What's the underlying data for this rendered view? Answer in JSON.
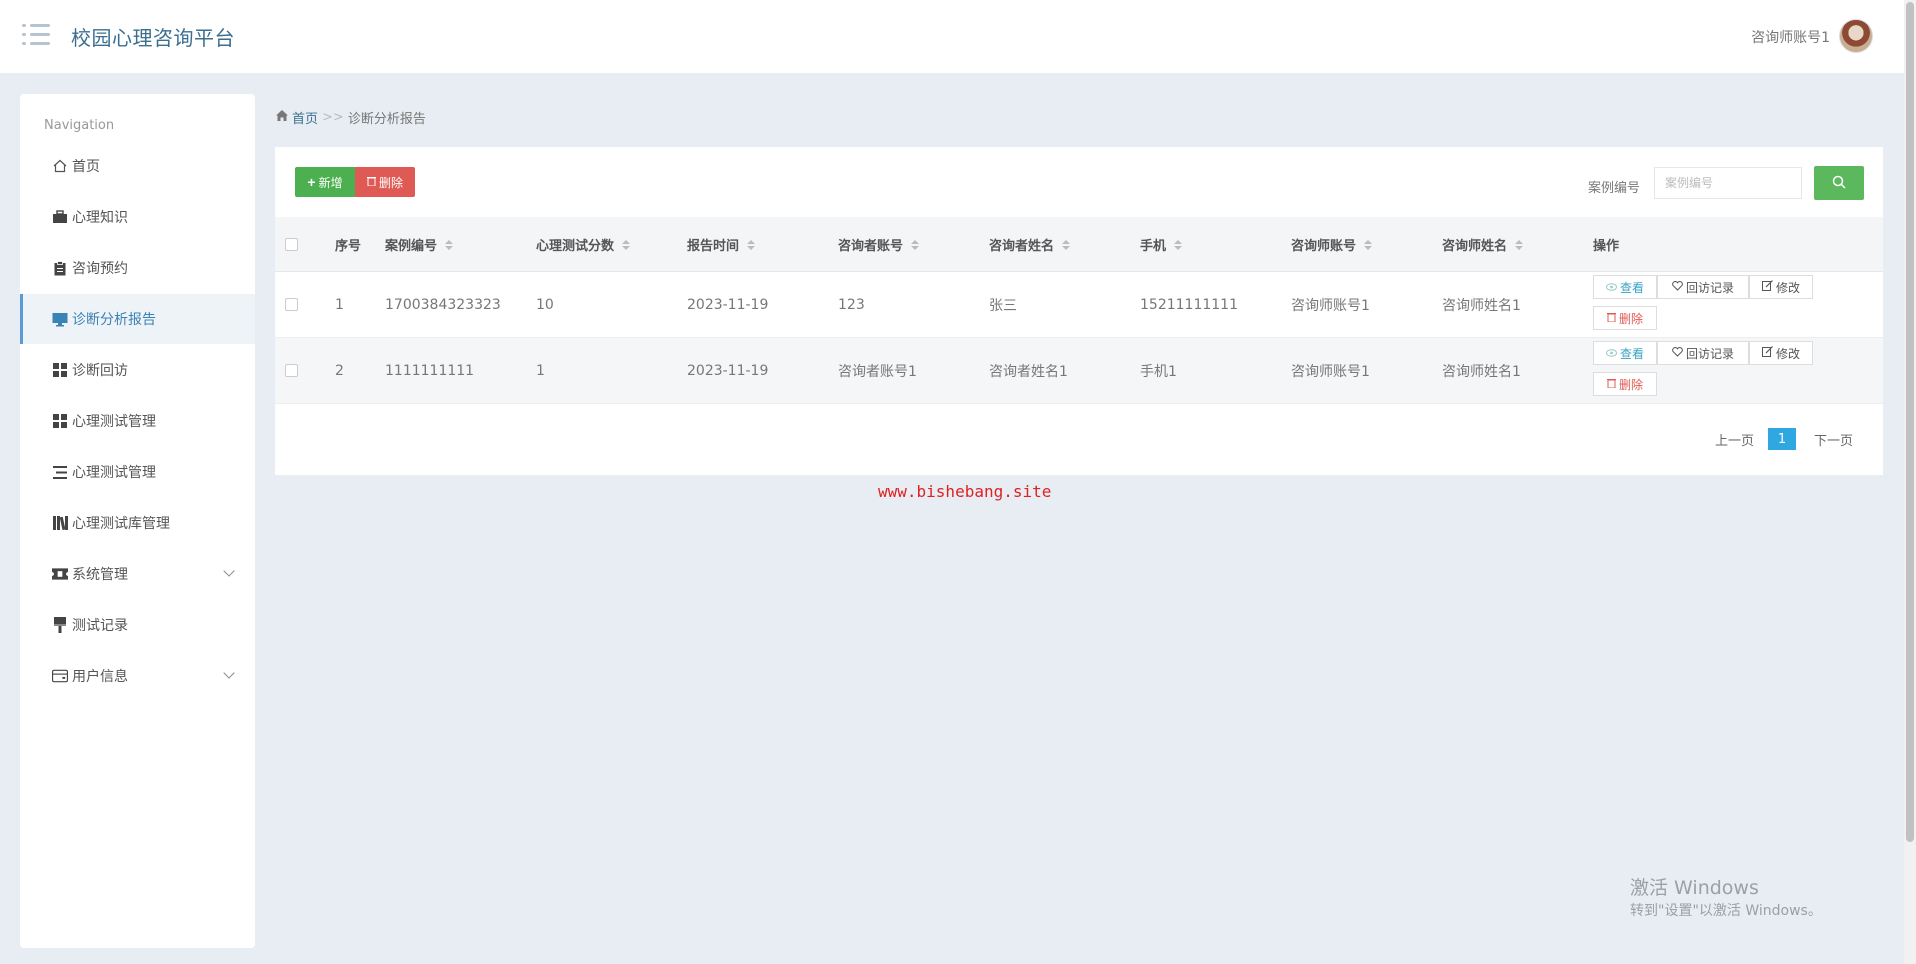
{
  "header": {
    "title": "校园心理咨询平台",
    "user_name": "咨询师账号1"
  },
  "sidebar": {
    "heading": "Navigation",
    "items": [
      {
        "label": "首页",
        "icon": "home-icon"
      },
      {
        "label": "心理知识",
        "icon": "briefcase-icon"
      },
      {
        "label": "咨询预约",
        "icon": "clipboard-icon"
      },
      {
        "label": "诊断分析报告",
        "icon": "monitor-icon",
        "active": true
      },
      {
        "label": "诊断回访",
        "icon": "grid-icon"
      },
      {
        "label": "心理测试管理",
        "icon": "grid-icon"
      },
      {
        "label": "心理测试管理",
        "icon": "list-icon"
      },
      {
        "label": "心理测试库管理",
        "icon": "books-icon"
      },
      {
        "label": "系统管理",
        "icon": "ticket-icon",
        "expandable": true
      },
      {
        "label": "测试记录",
        "icon": "brush-icon"
      },
      {
        "label": "用户信息",
        "icon": "wallet-icon",
        "expandable": true
      }
    ]
  },
  "breadcrumb": {
    "home": "首页",
    "separator": ">>",
    "current": "诊断分析报告"
  },
  "toolbar": {
    "add_label": "新增",
    "delete_label": "删除",
    "search_label": "案例编号",
    "search_placeholder": "案例编号"
  },
  "table": {
    "columns": [
      "序号",
      "案例编号",
      "心理测试分数",
      "报告时间",
      "咨询者账号",
      "咨询者姓名",
      "手机",
      "咨询师账号",
      "咨询师姓名",
      "操作"
    ],
    "rows": [
      {
        "index": "1",
        "case_no": "1700384323323",
        "score": "10",
        "time": "2023-11-19",
        "client_account": "123",
        "client_name": "张三",
        "phone": "15211111111",
        "counselor_account": "咨询师账号1",
        "counselor_name": "咨询师姓名1"
      },
      {
        "index": "2",
        "case_no": "1111111111",
        "score": "1",
        "time": "2023-11-19",
        "client_account": "咨询者账号1",
        "client_name": "咨询者姓名1",
        "phone": "手机1",
        "counselor_account": "咨询师账号1",
        "counselor_name": "咨询师姓名1"
      }
    ],
    "actions": {
      "view": "查看",
      "visit": "回访记录",
      "edit": "修改",
      "delete": "删除"
    }
  },
  "pagination": {
    "prev": "上一页",
    "current": "1",
    "next": "下一页"
  },
  "watermark": "www.bishebang.site",
  "windows_activation": {
    "title": "激活 Windows",
    "subtitle": "转到\"设置\"以激活 Windows。"
  },
  "colors": {
    "accent": "#3b6f8f",
    "add": "#4caf50",
    "delete": "#e05a55",
    "search": "#5cb85c",
    "page_current": "#2fa7e0"
  }
}
